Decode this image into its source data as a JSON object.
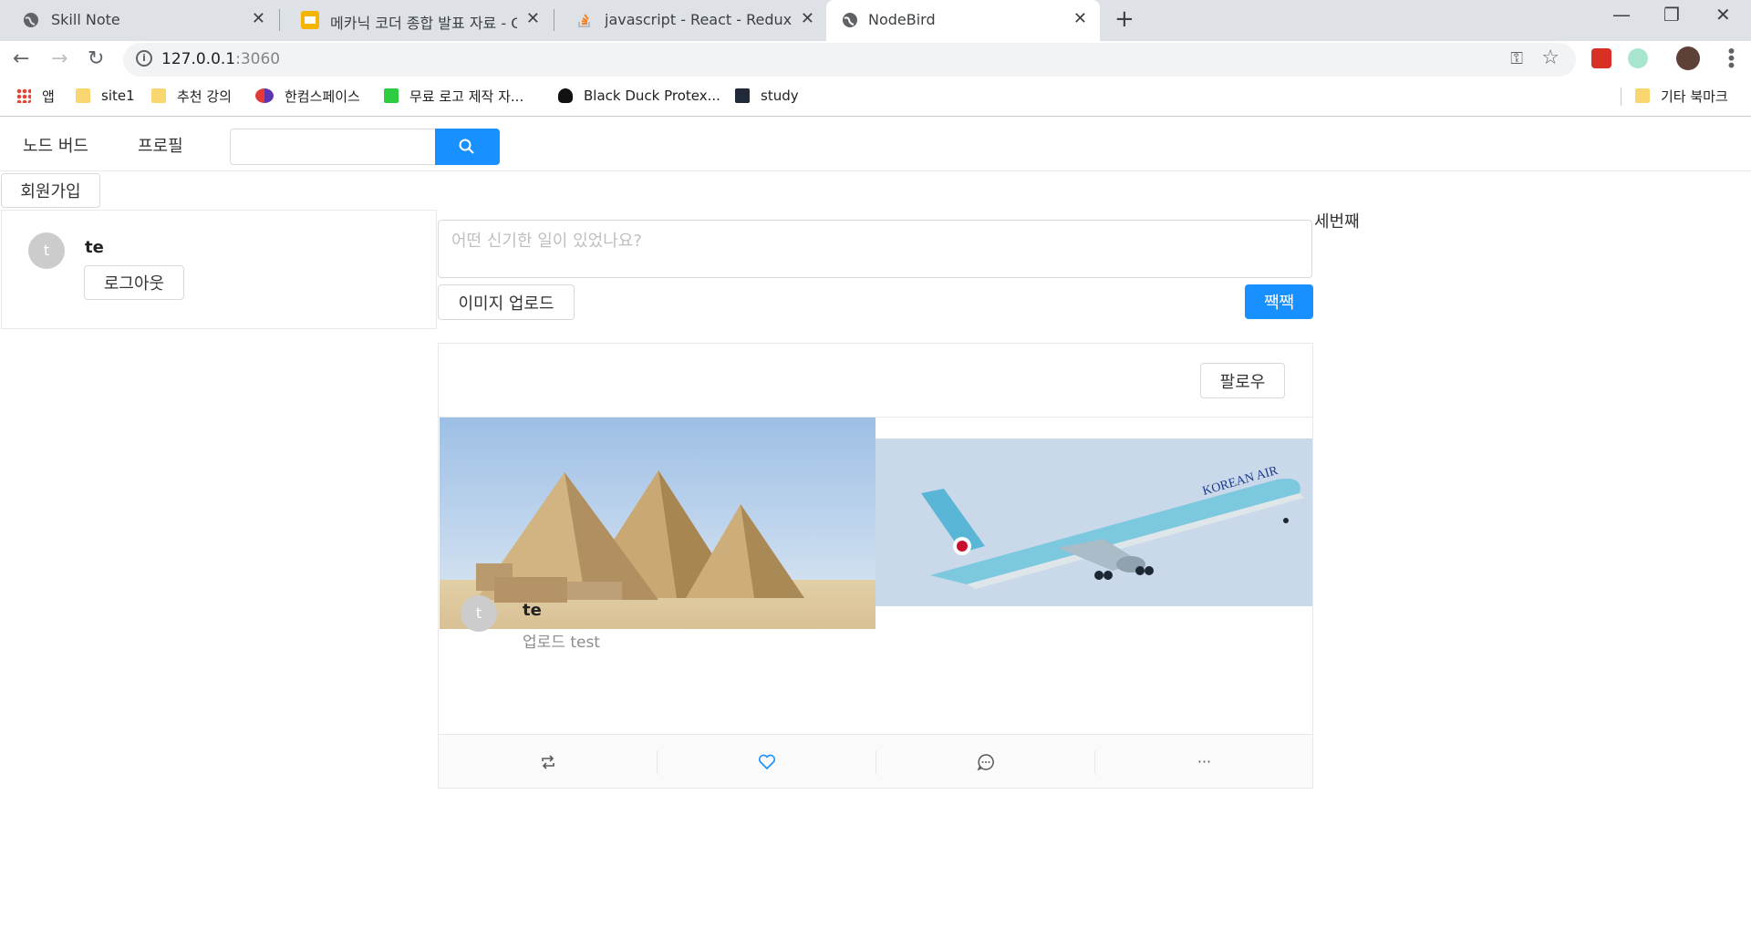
{
  "browser": {
    "tabs": [
      {
        "title": "Skill Note"
      },
      {
        "title": "메카닉 코더 종합 발표 자료 - Go"
      },
      {
        "title": "javascript - React - Redux App:"
      },
      {
        "title": "NodeBird"
      }
    ],
    "close_glyph": "✕",
    "new_tab_glyph": "+",
    "window_controls": {
      "minimize": "—",
      "maximize": "❐",
      "close": "✕"
    },
    "nav": {
      "back": "←",
      "forward": "→",
      "reload": "↻"
    },
    "url": {
      "host": "127.0.0.1",
      "port": ":3060"
    },
    "bookmarks": [
      {
        "label": "앱",
        "icon": "apps-grid-icon"
      },
      {
        "label": "site1",
        "icon": "folder-icon"
      },
      {
        "label": "추천 강의",
        "icon": "folder-icon"
      },
      {
        "label": "한컴스페이스",
        "icon": "hancom-icon"
      },
      {
        "label": "무료 로고 제작 자...",
        "icon": "logo-maker-icon"
      },
      {
        "label": "Black Duck Protex...",
        "icon": "black-duck-icon"
      },
      {
        "label": "study",
        "icon": "study-icon"
      }
    ],
    "other_bookmarks": "기타 북마크"
  },
  "app": {
    "menu": {
      "home": "노드 버드",
      "profile": "프로필"
    },
    "search": {
      "placeholder": ""
    },
    "signup": "회원가입",
    "user": {
      "avatar_letter": "t",
      "name": "te",
      "logout": "로그아웃"
    },
    "post_form": {
      "placeholder": "어떤 신기한 일이 있었나요?",
      "upload": "이미지 업로드",
      "submit": "짹짹"
    },
    "right_column": "세번째",
    "post": {
      "follow": "팔로우",
      "avatar_letter": "t",
      "author": "te",
      "content": "업로드 test",
      "more": "···"
    },
    "colors": {
      "primary": "#1890ff",
      "border": "#e8e8e8"
    }
  }
}
